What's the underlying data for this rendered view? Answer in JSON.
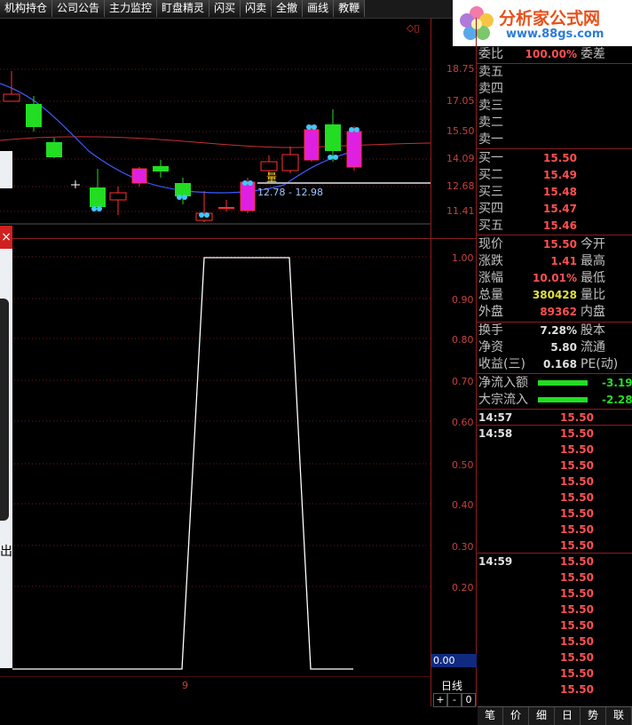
{
  "toolbar": {
    "buttons": [
      "机构持仓",
      "公司公告",
      "主力监控",
      "盯盘精灵",
      "闪买",
      "闪卖",
      "全撤",
      "画线",
      "教鞭"
    ]
  },
  "logo": {
    "brand": "分析家公式网",
    "url": "www.88gs.com"
  },
  "main_chart": {
    "price_axis": [
      "18.75",
      "17.05",
      "15.50",
      "14.09",
      "12.68",
      "11.41"
    ],
    "range_label": "12.78 - 12.98",
    "marker": "量",
    "corner_icons": "◇▯"
  },
  "indicator_chart": {
    "axis": [
      "1.00",
      "0.90",
      "0.80",
      "0.70",
      "0.60",
      "0.50",
      "0.40",
      "0.30",
      "0.20"
    ],
    "current_value": "0.00",
    "x_label": "9"
  },
  "period": {
    "label": "日线",
    "controls": [
      "+",
      "-",
      "0"
    ]
  },
  "side_fragments": {
    "close_glyph": "×",
    "partial_text": "出"
  },
  "order_book": {
    "top_row": {
      "label": "委比",
      "value": "100.00%",
      "right": "委差"
    },
    "asks": [
      {
        "label": "卖五",
        "price": ""
      },
      {
        "label": "卖四",
        "price": ""
      },
      {
        "label": "卖三",
        "price": ""
      },
      {
        "label": "卖二",
        "price": ""
      },
      {
        "label": "卖一",
        "price": ""
      }
    ],
    "bids": [
      {
        "label": "买一",
        "price": "15.50"
      },
      {
        "label": "买二",
        "price": "15.49"
      },
      {
        "label": "买三",
        "price": "15.48"
      },
      {
        "label": "买四",
        "price": "15.47"
      },
      {
        "label": "买五",
        "price": "15.46"
      }
    ]
  },
  "quote": [
    {
      "label": "现价",
      "value": "15.50",
      "right": "今开",
      "color": "#ff5050"
    },
    {
      "label": "涨跌",
      "value": "1.41",
      "right": "最高",
      "color": "#ff5050"
    },
    {
      "label": "涨幅",
      "value": "10.01%",
      "right": "最低",
      "color": "#ff5050"
    },
    {
      "label": "总量",
      "value": "380428",
      "right": "量比",
      "color": "#e0e040"
    },
    {
      "label": "外盘",
      "value": "89362",
      "right": "内盘",
      "color": "#ff5050"
    },
    {
      "label": "换手",
      "value": "7.28%",
      "right": "股本",
      "color": "#e0e0e0"
    },
    {
      "label": "净资",
      "value": "5.80",
      "right": "流通",
      "color": "#e0e0e0"
    },
    {
      "label": "收益(三)",
      "value": "0.168",
      "right": "PE(动)",
      "color": "#e0e0e0"
    }
  ],
  "flows": [
    {
      "label": "净流入额",
      "value": "-3.19"
    },
    {
      "label": "大宗流入",
      "value": "-2.28"
    }
  ],
  "ticks": [
    {
      "time": "14:57",
      "price": "15.50"
    },
    {
      "time": "14:58",
      "price": "15.50"
    },
    {
      "time": "",
      "price": "15.50"
    },
    {
      "time": "",
      "price": "15.50"
    },
    {
      "time": "",
      "price": "15.50"
    },
    {
      "time": "",
      "price": "15.50"
    },
    {
      "time": "",
      "price": "15.50"
    },
    {
      "time": "",
      "price": "15.50"
    },
    {
      "time": "",
      "price": "15.50"
    },
    {
      "time": "14:59",
      "price": "15.50"
    },
    {
      "time": "",
      "price": "15.50"
    },
    {
      "time": "",
      "price": "15.50"
    },
    {
      "time": "",
      "price": "15.50"
    },
    {
      "time": "",
      "price": "15.50"
    },
    {
      "time": "",
      "price": "15.50"
    },
    {
      "time": "",
      "price": "15.50"
    },
    {
      "time": "",
      "price": "15.50"
    },
    {
      "time": "",
      "price": "15.50"
    }
  ],
  "bottom_tabs": [
    "笔",
    "价",
    "细",
    "日",
    "势",
    "联"
  ]
}
